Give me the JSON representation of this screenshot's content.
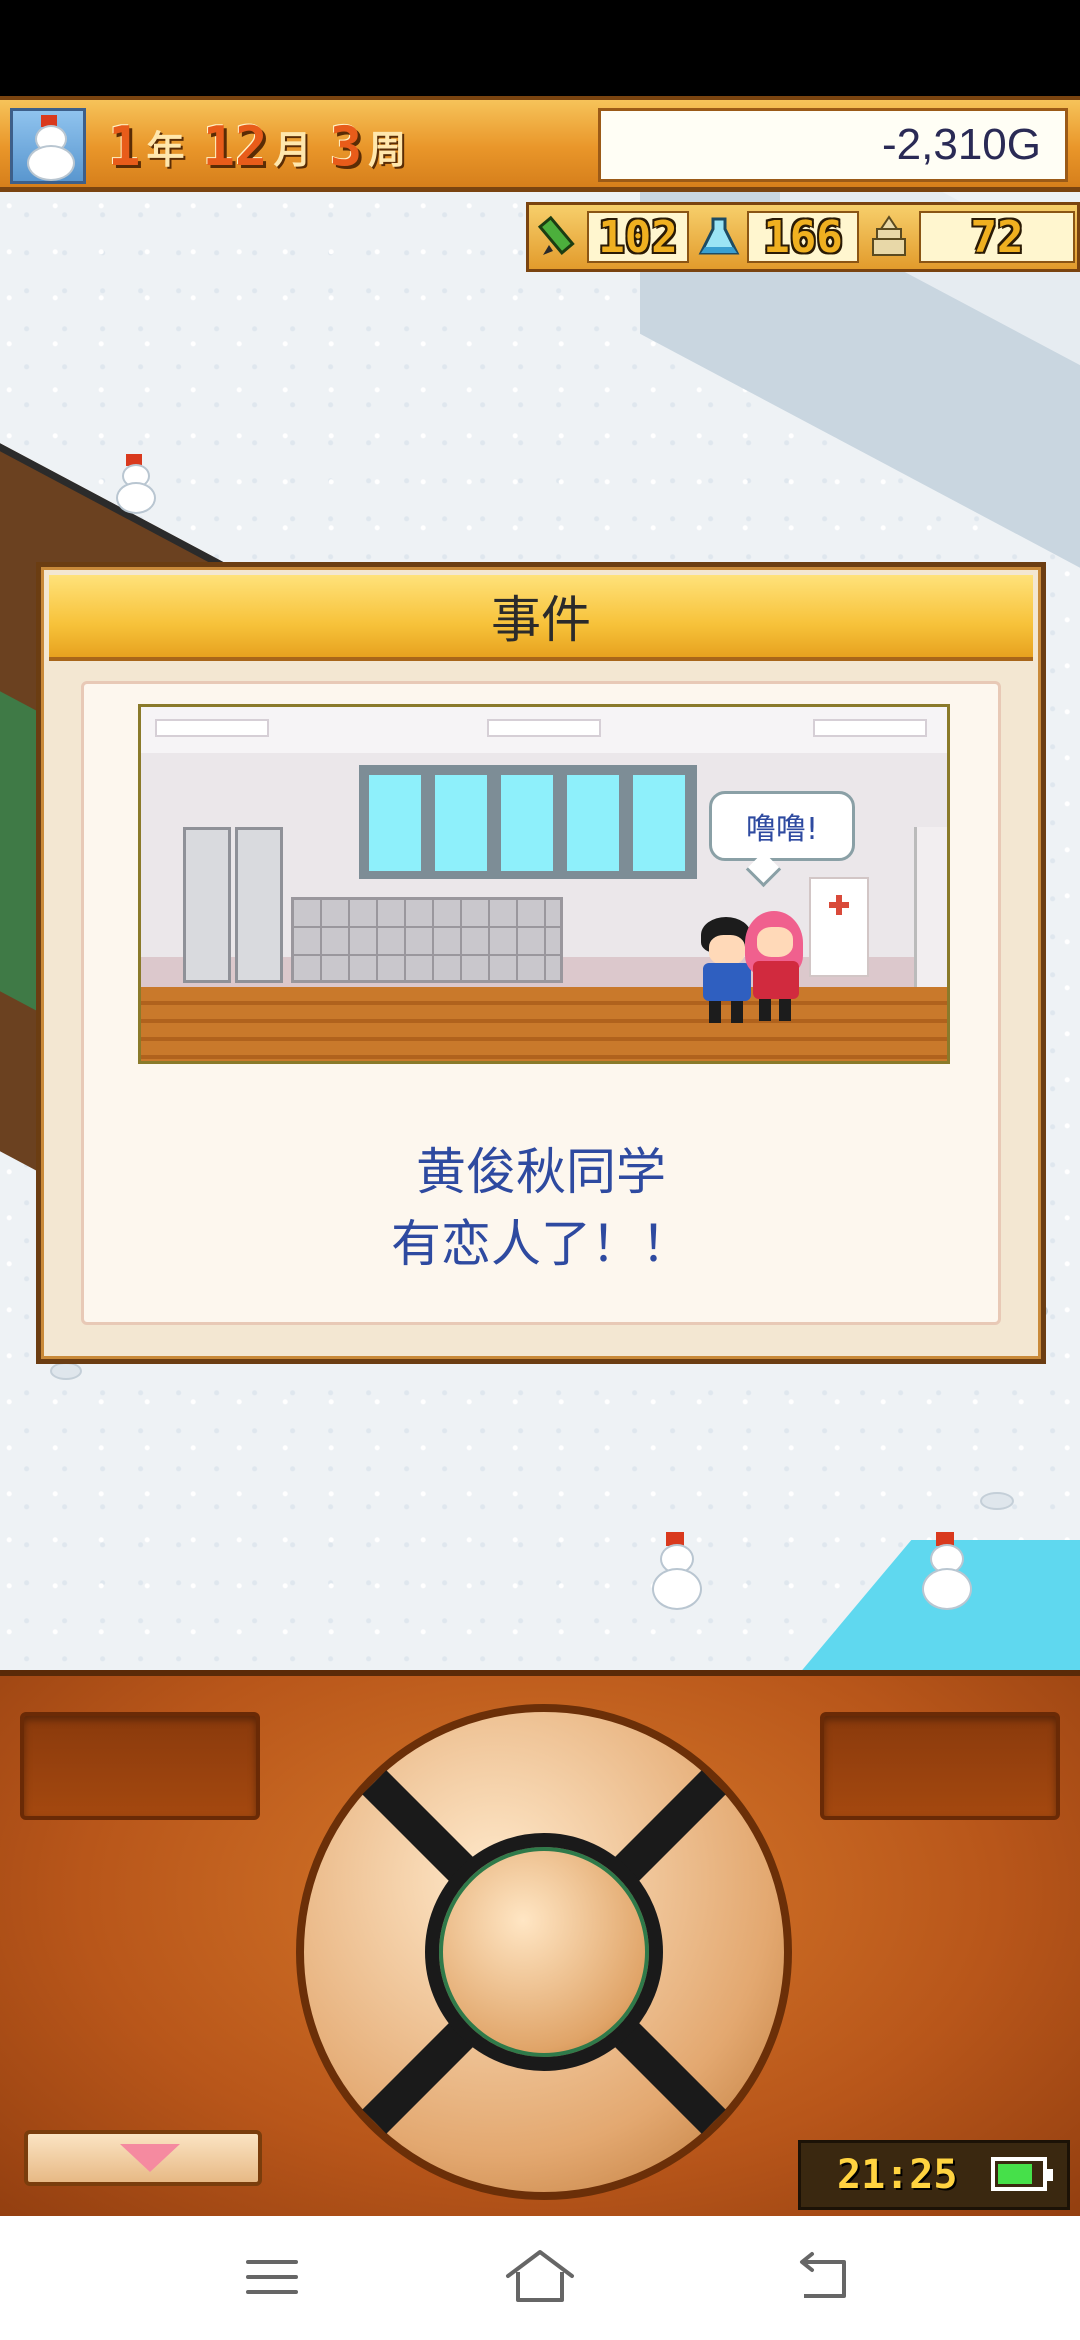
{
  "hud": {
    "year_value": "1",
    "year_unit": "年",
    "month_value": "12",
    "month_unit": "月",
    "week_value": "3",
    "week_unit": "周",
    "money": "-2,310G",
    "avatar_icon": "snowman-icon"
  },
  "stats": {
    "knowledge_icon": "pencil-icon",
    "knowledge_value": "102",
    "research_icon": "flask-icon",
    "research_value": "166",
    "tower_icon": "tower-icon",
    "tower_value": "72"
  },
  "event": {
    "title": "事件",
    "speech": "噜噜!",
    "message_line1": "黄俊秋同学",
    "message_line2": "有恋人了！！",
    "scene_description_icons": [
      "student-boy-icon",
      "student-girl-icon"
    ]
  },
  "controller": {
    "clock": "21:25",
    "battery_level": 0.8,
    "battery_color": "#46e04a",
    "menu_toggle_icon": "triangle-down-icon"
  },
  "nav": {
    "menu_icon": "menu-icon",
    "home_icon": "home-icon",
    "back_icon": "back-icon"
  },
  "colors": {
    "accent_orange": "#e9962a",
    "message_blue": "#2e4aa0",
    "stat_yellow": "#f0b020"
  }
}
